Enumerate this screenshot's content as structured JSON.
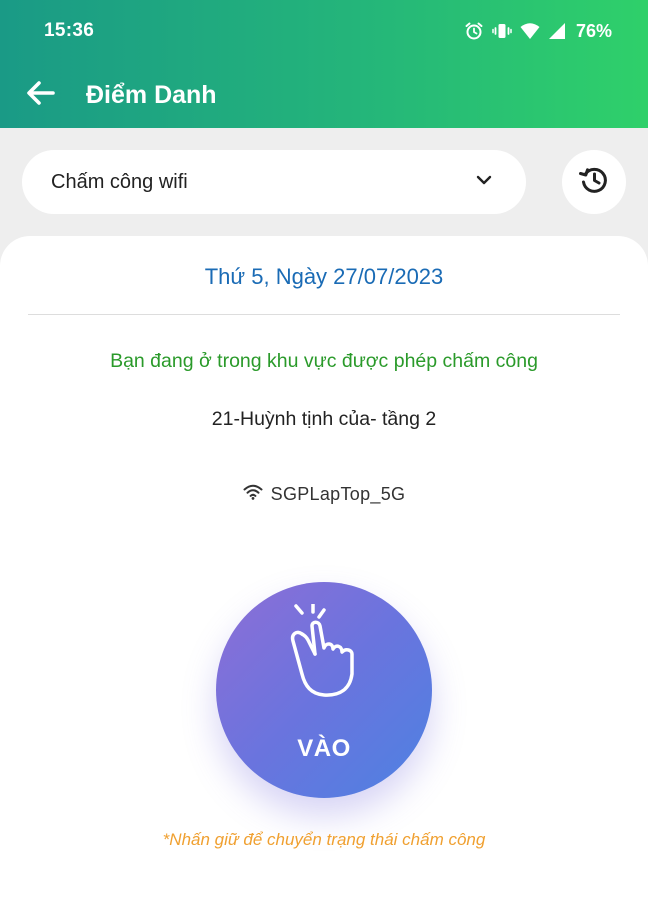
{
  "status_bar": {
    "time": "15:36",
    "battery": "76%",
    "icons": [
      "alarm-icon",
      "vibrate-icon",
      "wifi-icon",
      "signal-icon"
    ]
  },
  "app_bar": {
    "title": "Điểm Danh",
    "back_icon": "arrow-left-icon"
  },
  "mode_selector": {
    "value": "Chấm công wifi",
    "icon": "chevron-down-icon"
  },
  "history_button": {
    "icon": "history-icon"
  },
  "attendance": {
    "date": "Thứ 5, Ngày 27/07/2023",
    "zone_message": "Bạn đang ở trong khu vực được phép chấm công",
    "location": "21-Huỳnh tịnh của- tầng 2",
    "wifi_name": "SGPLapTop_5G",
    "checkin_label": "VÀO",
    "hint": "*Nhấn giữ để chuyển trạng thái chấm công"
  },
  "colors": {
    "header_gradient_start": "#1a9a86",
    "header_gradient_end": "#2fd06a",
    "date_text": "#1a6bb5",
    "zone_message": "#2a9a2a",
    "hint": "#f0a030",
    "button_gradient_start": "#8e6ed6",
    "button_gradient_end": "#4d82e2"
  }
}
